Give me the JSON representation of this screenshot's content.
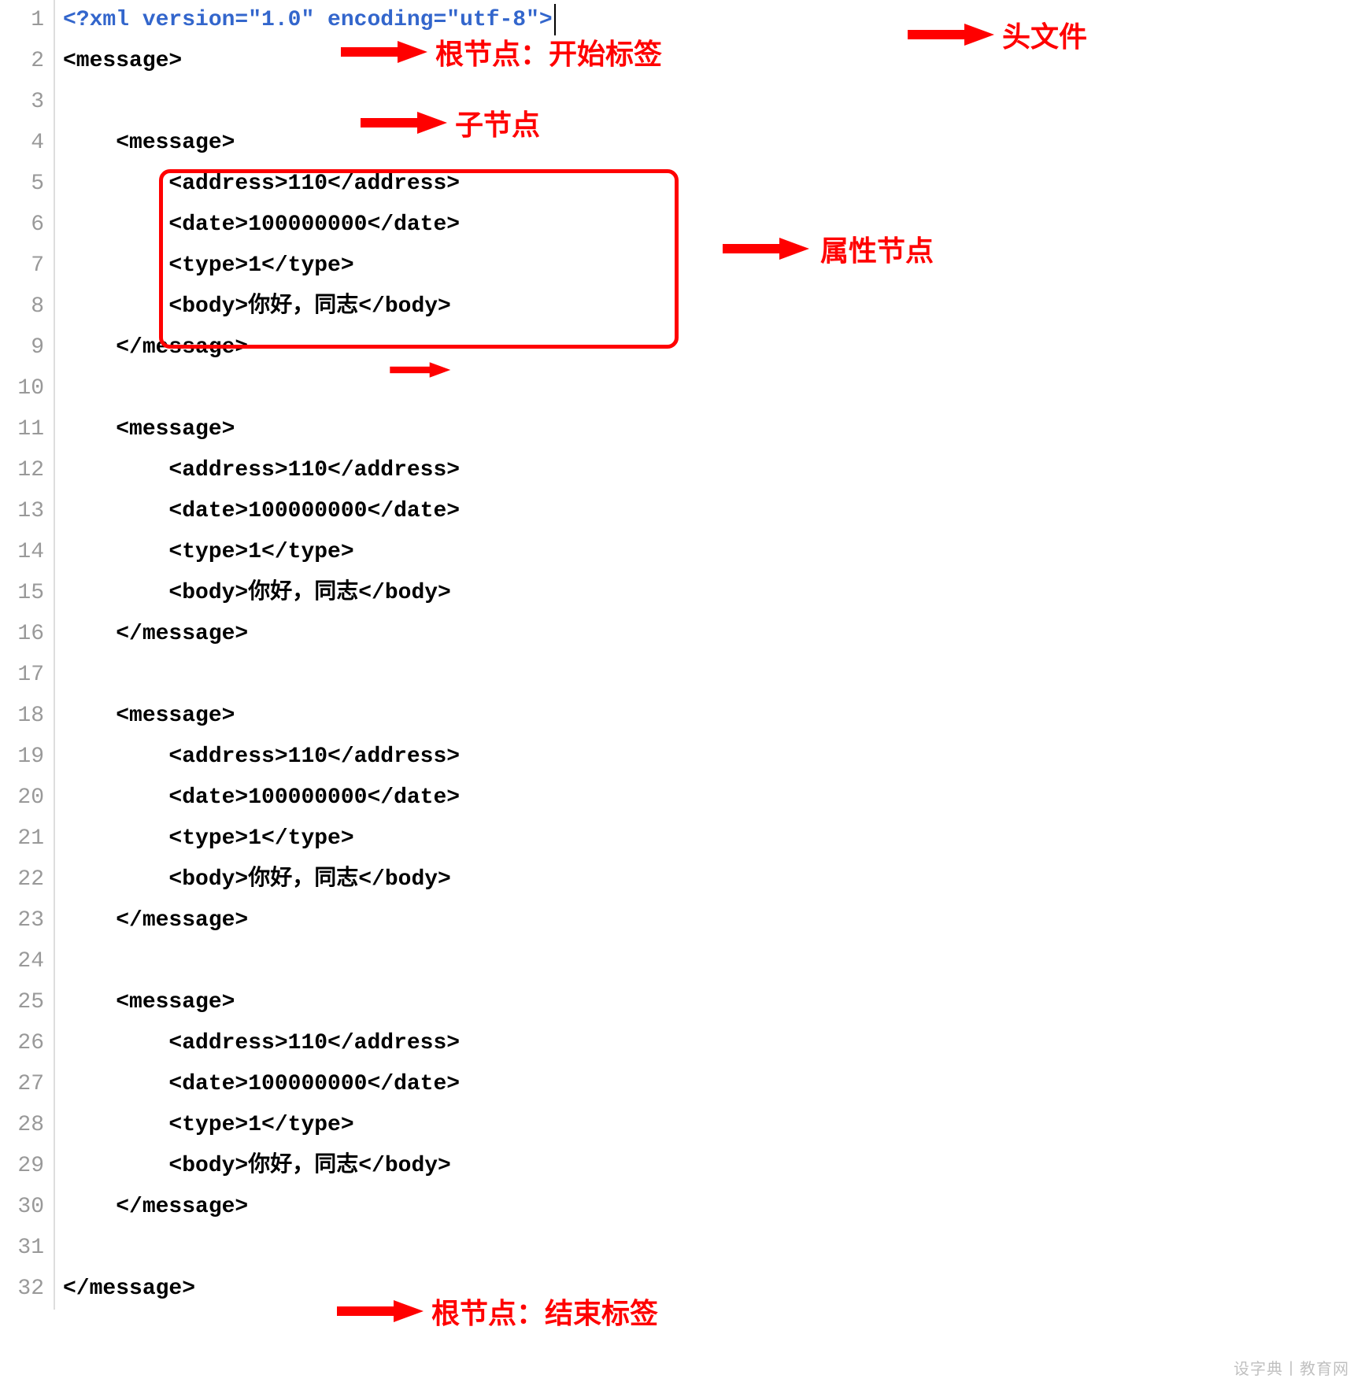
{
  "colors": {
    "annotation": "#ff0000",
    "xml_declaration": "#3366cc",
    "line_number": "#999999"
  },
  "line_numbers": [
    "1",
    "2",
    "3",
    "4",
    "5",
    "6",
    "7",
    "8",
    "9",
    "10",
    "11",
    "12",
    "13",
    "14",
    "15",
    "16",
    "17",
    "18",
    "19",
    "20",
    "21",
    "22",
    "23",
    "24",
    "25",
    "26",
    "27",
    "28",
    "29",
    "30",
    "31",
    "32"
  ],
  "code_lines": {
    "l1": "<?xml version=\"1.0\" encoding=\"utf-8\">",
    "l2": "<message>",
    "l3": "",
    "l4": "    <message>",
    "l5": "        <address>110</address>",
    "l6": "        <date>100000000</date>",
    "l7": "        <type>1</type>",
    "l8": "        <body>你好，同志</body>",
    "l9": "    </message>",
    "l10": "",
    "l11": "    <message>",
    "l12": "        <address>110</address>",
    "l13": "        <date>100000000</date>",
    "l14": "        <type>1</type>",
    "l15": "        <body>你好，同志</body>",
    "l16": "    </message>",
    "l17": "",
    "l18": "    <message>",
    "l19": "        <address>110</address>",
    "l20": "        <date>100000000</date>",
    "l21": "        <type>1</type>",
    "l22": "        <body>你好，同志</body>",
    "l23": "    </message>",
    "l24": "",
    "l25": "    <message>",
    "l26": "        <address>110</address>",
    "l27": "        <date>100000000</date>",
    "l28": "        <type>1</type>",
    "l29": "        <body>你好，同志</body>",
    "l30": "    </message>",
    "l31": "",
    "l32": "</message>"
  },
  "annotations": {
    "header_file": "头文件",
    "root_start_tag": "根节点：开始标签",
    "child_node": "子节点",
    "attribute_node": "属性节点",
    "root_end_tag": "根节点：结束标签"
  },
  "watermark": "设字典丨教育网"
}
